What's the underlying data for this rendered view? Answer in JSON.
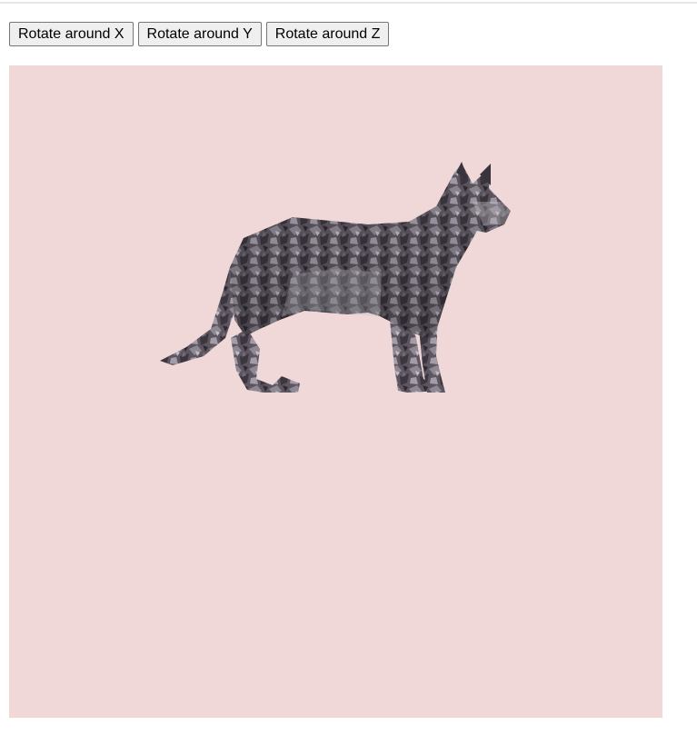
{
  "toolbar": {
    "buttons": [
      {
        "label": "Rotate around X",
        "name": "rotate-x-button"
      },
      {
        "label": "Rotate around Y",
        "name": "rotate-y-button"
      },
      {
        "label": "Rotate around Z",
        "name": "rotate-z-button"
      }
    ]
  },
  "scene": {
    "background_color": "#f0d8d9",
    "model": "cat",
    "model_texture": "tabby-fur"
  }
}
